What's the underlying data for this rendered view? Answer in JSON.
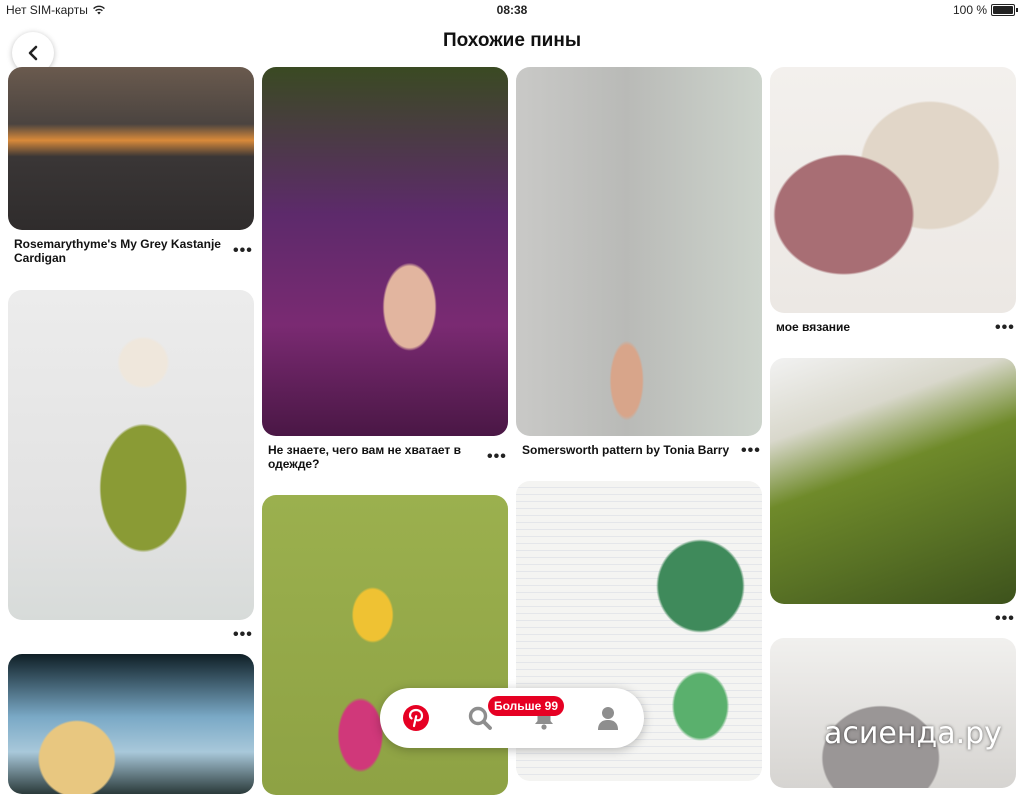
{
  "status_bar": {
    "carrier": "Нет SIM-карты",
    "time": "08:38",
    "battery": "100 %"
  },
  "header": {
    "title": "Похожие пины"
  },
  "pins": [
    {
      "caption": "Rosemarythyme's My Grey Kastanje Cardigan",
      "more": "•••"
    },
    {
      "caption": "",
      "more": "•••"
    },
    {
      "caption": "Не знаете, чего вам не хватает в одежде?",
      "more": "•••"
    },
    {
      "caption": "",
      "more": ""
    },
    {
      "caption": "Somersworth pattern by Tonia Barry",
      "more": "•••"
    },
    {
      "caption": "",
      "more": ""
    },
    {
      "caption": "мое вязание",
      "more": "•••"
    },
    {
      "caption": "",
      "more": "•••"
    },
    {
      "caption": "",
      "more": ""
    },
    {
      "caption": "",
      "more": ""
    }
  ],
  "tabbar": {
    "badge": "Больше 99",
    "icons": [
      "pinterest-logo-icon",
      "search-icon",
      "bell-icon",
      "profile-icon"
    ]
  },
  "watermark": "асиенда.ру",
  "colors": {
    "brand": "#e60023",
    "tab_inactive": "#8e8e8e"
  }
}
